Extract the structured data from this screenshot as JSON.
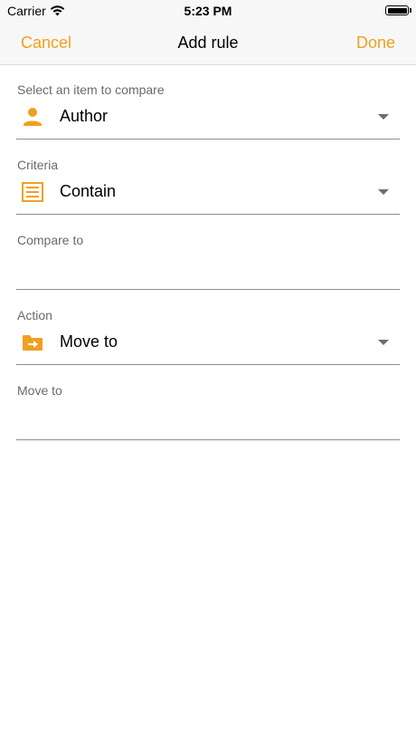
{
  "status": {
    "carrier": "Carrier",
    "time": "5:23 PM"
  },
  "nav": {
    "cancel": "Cancel",
    "title": "Add rule",
    "done": "Done"
  },
  "accent_color": "#f0a020",
  "fields": {
    "compare_item": {
      "label": "Select an item to compare",
      "value": "Author",
      "icon": "person-icon"
    },
    "criteria": {
      "label": "Criteria",
      "value": "Contain",
      "icon": "list-icon"
    },
    "compare_to": {
      "label": "Compare to",
      "value": ""
    },
    "action": {
      "label": "Action",
      "value": "Move to",
      "icon": "folder-move-icon"
    },
    "move_to": {
      "label": "Move to",
      "value": ""
    }
  }
}
